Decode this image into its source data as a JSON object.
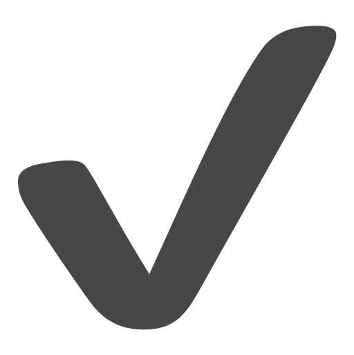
{
  "icon": {
    "name": "checkmark-icon",
    "color": "#474747",
    "background": "#ffffff"
  }
}
